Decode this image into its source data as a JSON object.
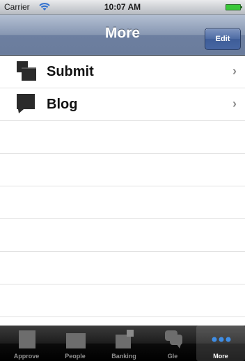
{
  "status": {
    "carrier": "Carrier",
    "time": "10:07 AM"
  },
  "nav": {
    "title": "More",
    "edit_label": "Edit"
  },
  "rows": [
    {
      "label": "Submit",
      "icon": "submit-icon"
    },
    {
      "label": "Blog",
      "icon": "blog-icon"
    }
  ],
  "tabs": [
    {
      "label": "Approve",
      "icon": "approve-icon",
      "selected": false
    },
    {
      "label": "People",
      "icon": "people-icon",
      "selected": false
    },
    {
      "label": "Banking",
      "icon": "banking-icon",
      "selected": false
    },
    {
      "label": "Gle",
      "icon": "chat-icon",
      "selected": false
    },
    {
      "label": "More",
      "icon": "more-dots-icon",
      "selected": true
    }
  ],
  "colors": {
    "nav_bg": "#7585a3",
    "edit_bg": "#4766a2",
    "tab_bg": "#1d1d1d"
  }
}
